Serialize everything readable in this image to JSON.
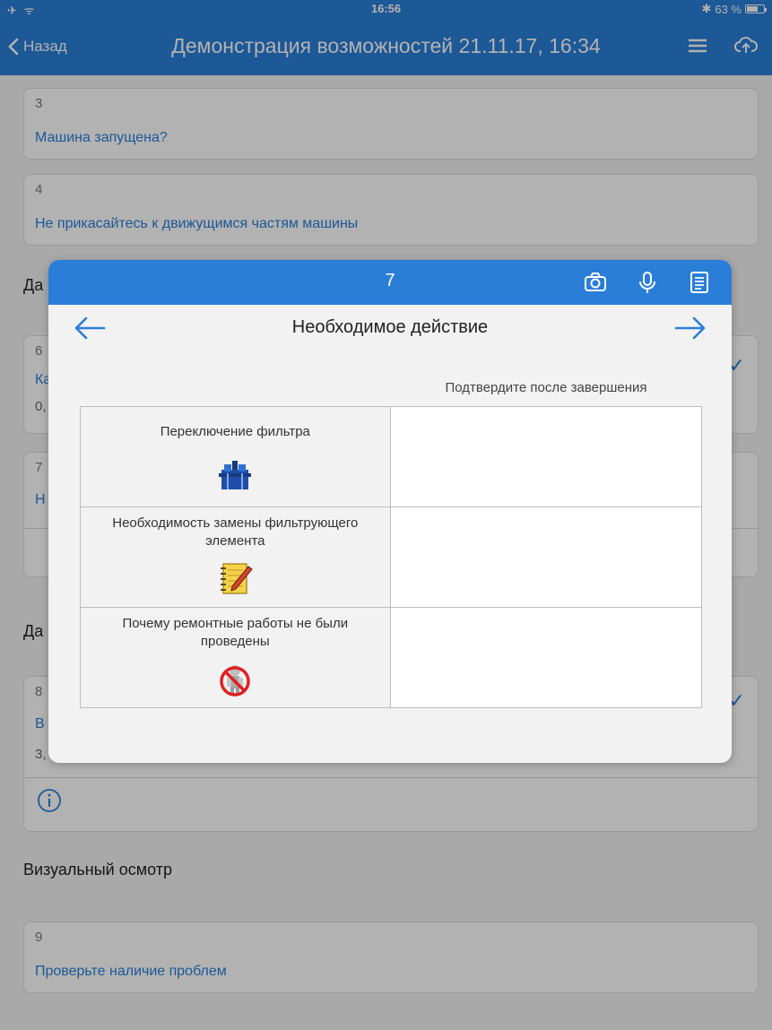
{
  "status": {
    "time": "16:56",
    "battery": "63 %",
    "battery_level": 0.63
  },
  "nav": {
    "back_label": "Назад",
    "title": "Демонстрация возможностей 21.11.17, 16:34"
  },
  "list": {
    "cards": [
      {
        "num": "3",
        "label": "Машина запущена?"
      },
      {
        "num": "4",
        "label": "Не прикасайтесь к движущимся частям машины"
      },
      {
        "num": "6",
        "label": "Ка",
        "value": "0,"
      },
      {
        "num": "7",
        "label": "Н"
      },
      {
        "num": "8",
        "label": "В",
        "value": "3,"
      },
      {
        "num": "9",
        "label": "Проверьте наличие проблем"
      }
    ],
    "sections": [
      "Да",
      "Да",
      "Визуальный осмотр"
    ]
  },
  "modal": {
    "number": "7",
    "title": "Необходимое действие",
    "column_header": "Подтвердите после завершения",
    "rows": [
      {
        "label": "Переключение фильтра",
        "icon": "filter-icon"
      },
      {
        "label": "Необходимость замены фильтрующего элемента",
        "icon": "notepad-icon"
      },
      {
        "label": "Почему ремонтные работы не были проведены",
        "icon": "prohibited-worker-icon"
      }
    ]
  },
  "colors": {
    "accent": "#2a7ed8",
    "background": "#f2f2f2"
  }
}
